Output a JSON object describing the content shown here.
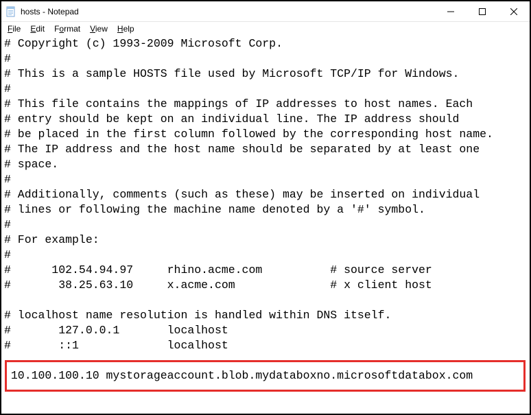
{
  "window": {
    "title": "hosts - Notepad"
  },
  "menu": {
    "file": {
      "label": "File",
      "ul": "F",
      "rest": "ile"
    },
    "edit": {
      "label": "Edit",
      "ul": "E",
      "rest": "dit"
    },
    "format": {
      "label": "Format",
      "ul": "o",
      "pre": "F",
      "rest": "rmat"
    },
    "view": {
      "label": "View",
      "ul": "V",
      "rest": "iew"
    },
    "help": {
      "label": "Help",
      "ul": "H",
      "rest": "elp"
    }
  },
  "content": {
    "lines": [
      "# Copyright (c) 1993-2009 Microsoft Corp.",
      "#",
      "# This is a sample HOSTS file used by Microsoft TCP/IP for Windows.",
      "#",
      "# This file contains the mappings of IP addresses to host names. Each",
      "# entry should be kept on an individual line. The IP address should",
      "# be placed in the first column followed by the corresponding host name.",
      "# The IP address and the host name should be separated by at least one",
      "# space.",
      "#",
      "# Additionally, comments (such as these) may be inserted on individual",
      "# lines or following the machine name denoted by a '#' symbol.",
      "#",
      "# For example:",
      "#",
      "#      102.54.94.97     rhino.acme.com          # source server",
      "#       38.25.63.10     x.acme.com              # x client host",
      "",
      "# localhost name resolution is handled within DNS itself.",
      "#       127.0.0.1       localhost",
      "#       ::1             localhost",
      "",
      " 10.100.100.10 mystorageaccount.blob.mydataboxno.microsoftdatabox.com"
    ],
    "highlight_line_index": 22
  }
}
